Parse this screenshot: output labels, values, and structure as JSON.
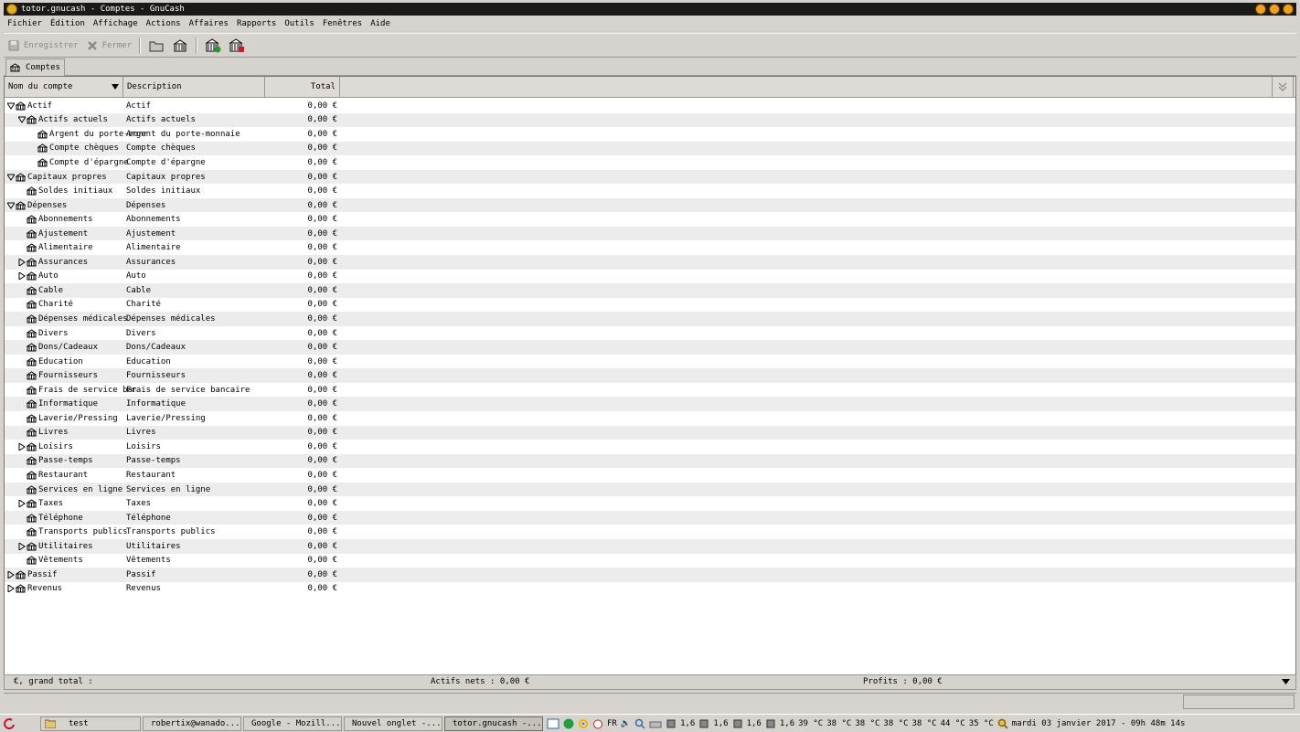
{
  "window": {
    "title": "totor.gnucash - Comptes - GnuCash"
  },
  "menu": [
    "Fichier",
    "Édition",
    "Affichage",
    "Actions",
    "Affaires",
    "Rapports",
    "Outils",
    "Fenêtres",
    "Aide"
  ],
  "toolbar": {
    "save": "Enregistrer",
    "close": "Fermer"
  },
  "tab": {
    "label": "Comptes"
  },
  "columns": {
    "name": "Nom du compte",
    "description": "Description",
    "total": "Total"
  },
  "accounts": [
    {
      "name": "Actif",
      "desc": "Actif",
      "total": "0,00 €",
      "level": 0,
      "exp": "open"
    },
    {
      "name": "Actifs actuels",
      "desc": "Actifs actuels",
      "total": "0,00 €",
      "level": 1,
      "exp": "open"
    },
    {
      "name": "Argent du porte-monnaie",
      "desc": "Argent du porte-monnaie",
      "total": "0,00 €",
      "level": 2,
      "exp": "none"
    },
    {
      "name": "Compte chèques",
      "desc": "Compte chèques",
      "total": "0,00 €",
      "level": 2,
      "exp": "none"
    },
    {
      "name": "Compte d'épargne",
      "desc": "Compte d'épargne",
      "total": "0,00 €",
      "level": 2,
      "exp": "none"
    },
    {
      "name": "Capitaux propres",
      "desc": "Capitaux propres",
      "total": "0,00 €",
      "level": 0,
      "exp": "open"
    },
    {
      "name": "Soldes initiaux",
      "desc": "Soldes initiaux",
      "total": "0,00 €",
      "level": 1,
      "exp": "none"
    },
    {
      "name": "Dépenses",
      "desc": "Dépenses",
      "total": "0,00 €",
      "level": 0,
      "exp": "open"
    },
    {
      "name": "Abonnements",
      "desc": "Abonnements",
      "total": "0,00 €",
      "level": 1,
      "exp": "none"
    },
    {
      "name": "Ajustement",
      "desc": "Ajustement",
      "total": "0,00 €",
      "level": 1,
      "exp": "none"
    },
    {
      "name": "Alimentaire",
      "desc": "Alimentaire",
      "total": "0,00 €",
      "level": 1,
      "exp": "none"
    },
    {
      "name": "Assurances",
      "desc": "Assurances",
      "total": "0,00 €",
      "level": 1,
      "exp": "closed"
    },
    {
      "name": "Auto",
      "desc": "Auto",
      "total": "0,00 €",
      "level": 1,
      "exp": "closed"
    },
    {
      "name": "Cable",
      "desc": "Cable",
      "total": "0,00 €",
      "level": 1,
      "exp": "none"
    },
    {
      "name": "Charité",
      "desc": "Charité",
      "total": "0,00 €",
      "level": 1,
      "exp": "none"
    },
    {
      "name": "Dépenses médicales",
      "desc": "Dépenses médicales",
      "total": "0,00 €",
      "level": 1,
      "exp": "none"
    },
    {
      "name": "Divers",
      "desc": "Divers",
      "total": "0,00 €",
      "level": 1,
      "exp": "none"
    },
    {
      "name": "Dons/Cadeaux",
      "desc": "Dons/Cadeaux",
      "total": "0,00 €",
      "level": 1,
      "exp": "none"
    },
    {
      "name": "Education",
      "desc": "Education",
      "total": "0,00 €",
      "level": 1,
      "exp": "none"
    },
    {
      "name": "Fournisseurs",
      "desc": "Fournisseurs",
      "total": "0,00 €",
      "level": 1,
      "exp": "none"
    },
    {
      "name": "Frais de service bancaire",
      "desc": "Frais de service bancaire",
      "total": "0,00 €",
      "level": 1,
      "exp": "none"
    },
    {
      "name": "Informatique",
      "desc": "Informatique",
      "total": "0,00 €",
      "level": 1,
      "exp": "none"
    },
    {
      "name": "Laverie/Pressing",
      "desc": "Laverie/Pressing",
      "total": "0,00 €",
      "level": 1,
      "exp": "none"
    },
    {
      "name": "Livres",
      "desc": "Livres",
      "total": "0,00 €",
      "level": 1,
      "exp": "none"
    },
    {
      "name": "Loisirs",
      "desc": "Loisirs",
      "total": "0,00 €",
      "level": 1,
      "exp": "closed"
    },
    {
      "name": "Passe-temps",
      "desc": "Passe-temps",
      "total": "0,00 €",
      "level": 1,
      "exp": "none"
    },
    {
      "name": "Restaurant",
      "desc": "Restaurant",
      "total": "0,00 €",
      "level": 1,
      "exp": "none"
    },
    {
      "name": "Services en ligne",
      "desc": "Services en ligne",
      "total": "0,00 €",
      "level": 1,
      "exp": "none"
    },
    {
      "name": "Taxes",
      "desc": "Taxes",
      "total": "0,00 €",
      "level": 1,
      "exp": "closed"
    },
    {
      "name": "Téléphone",
      "desc": "Téléphone",
      "total": "0,00 €",
      "level": 1,
      "exp": "none"
    },
    {
      "name": "Transports publics",
      "desc": "Transports publics",
      "total": "0,00 €",
      "level": 1,
      "exp": "none"
    },
    {
      "name": "Utilitaires",
      "desc": "Utilitaires",
      "total": "0,00 €",
      "level": 1,
      "exp": "closed"
    },
    {
      "name": "Vêtements",
      "desc": "Vêtements",
      "total": "0,00 €",
      "level": 1,
      "exp": "none"
    },
    {
      "name": "Passif",
      "desc": "Passif",
      "total": "0,00 €",
      "level": 0,
      "exp": "closed"
    },
    {
      "name": "Revenus",
      "desc": "Revenus",
      "total": "0,00 €",
      "level": 0,
      "exp": "closed"
    }
  ],
  "summary": {
    "grand_total": "€, grand total :",
    "net_assets": "Actifs nets : 0,00 €",
    "profits": "Profits : 0,00 €"
  },
  "taskbar": {
    "tasks": [
      "test",
      "robertix@wanado...",
      "Google - Mozill...",
      "Nouvel onglet -...",
      "totor.gnucash -..."
    ],
    "lang": "FR",
    "cpu": [
      "1,6",
      "1,6",
      "1,6",
      "1,6"
    ],
    "temps": [
      "39 °C",
      "38 °C",
      "38 °C",
      "38 °C",
      "38 °C",
      "44 °C",
      "35 °C"
    ],
    "clock": "mardi 03 janvier 2017 - 09h 48m 14s"
  }
}
